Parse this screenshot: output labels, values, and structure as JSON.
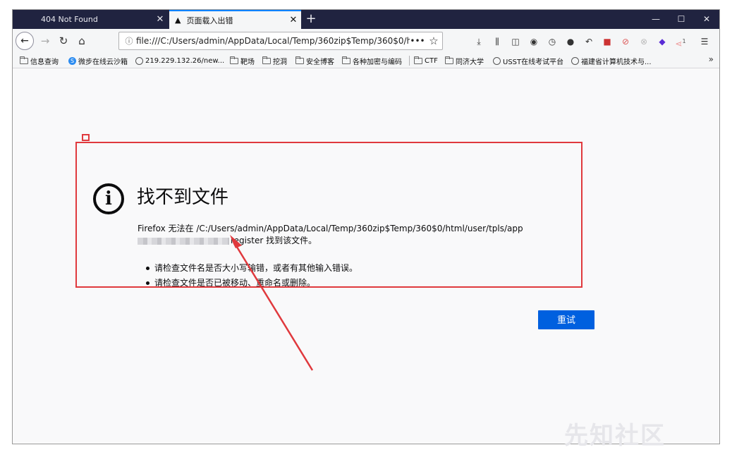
{
  "tabs": [
    {
      "label": "404 Not Found"
    },
    {
      "label": "页面载入出错"
    }
  ],
  "nav": {
    "url": "file:///C:/Users/admin/AppData/Local/Temp/360zip$Temp/360$0/htm",
    "more_label": "•••"
  },
  "window": {
    "minimize": "—",
    "maximize": "☐",
    "close": "✕"
  },
  "bookmarks": [
    {
      "label": "信息查询",
      "type": "folder"
    },
    {
      "label": "微步在线云沙箱",
      "type": "site"
    },
    {
      "label": "219.229.132.26/new...",
      "type": "globe"
    },
    {
      "label": "靶场",
      "type": "folder"
    },
    {
      "label": "挖洞",
      "type": "folder"
    },
    {
      "label": "安全博客",
      "type": "folder"
    },
    {
      "label": "各种加密与编码",
      "type": "folder"
    },
    {
      "label": "CTF",
      "type": "folder"
    },
    {
      "label": "同济大学",
      "type": "folder"
    },
    {
      "label": "USST在线考试平台",
      "type": "globe"
    },
    {
      "label": "福建省计算机技术与...",
      "type": "globe"
    }
  ],
  "error": {
    "title": "找不到文件",
    "desc_line1": "Firefox 无法在 /C:/Users/admin/AppData/Local/Temp/360zip$Temp/360$0/html/user/tpls/app",
    "desc_line2": "register 找到该文件。",
    "bullets": [
      "请检查文件名是否大小写输错，或者有其他输入错误。",
      "请检查文件是否已被移动、重命名或删除。"
    ],
    "retry_label": "重试"
  },
  "toolbar_badge": "1",
  "watermark": "先知社区",
  "colors": {
    "annotation": "#e0393d",
    "primary_button": "#0060df",
    "tab_bar": "#202340"
  }
}
